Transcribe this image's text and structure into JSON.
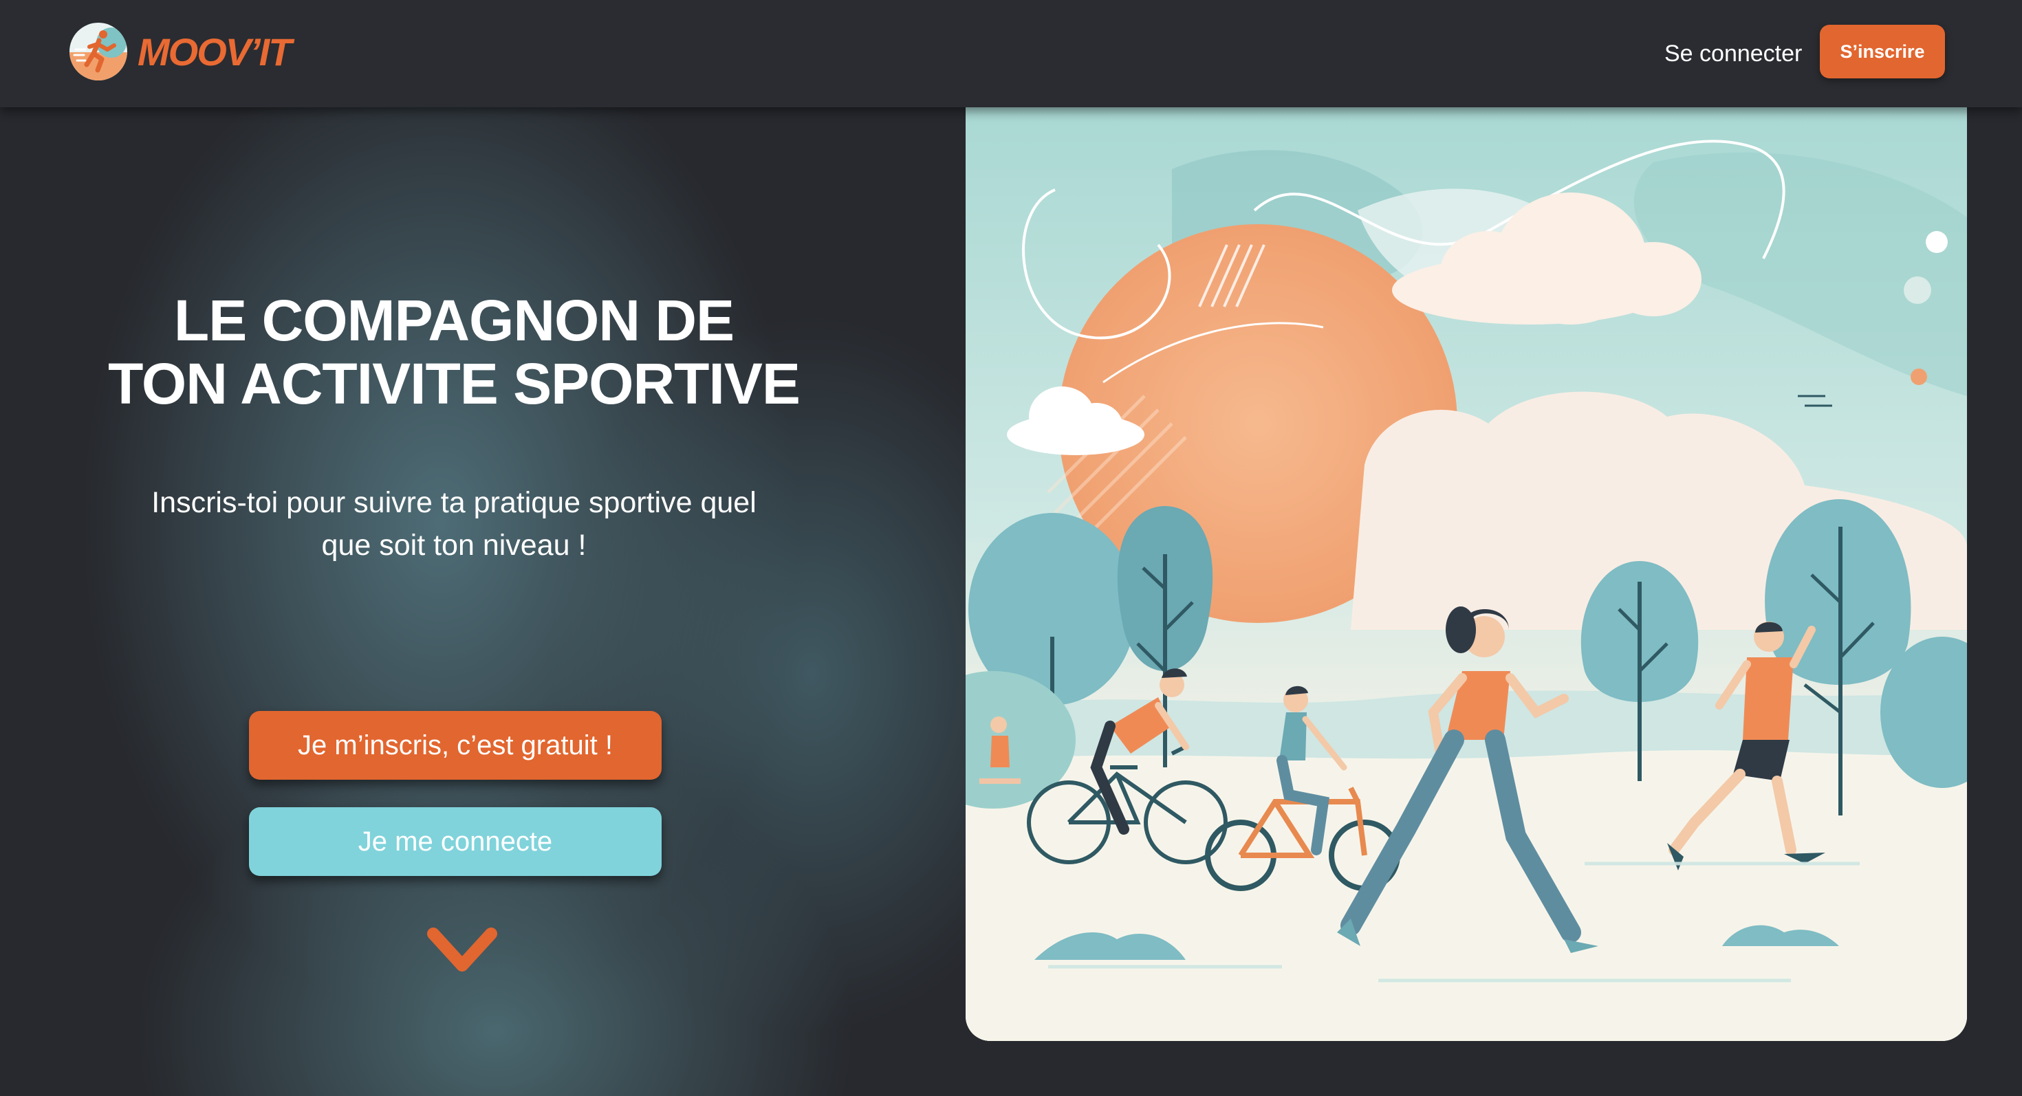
{
  "navbar": {
    "logo_text": "MOOV’IT",
    "login_label": "Se connecter",
    "signup_label": "S’inscrire"
  },
  "hero": {
    "title_line1": "LE COMPAGNON DE",
    "title_line2": "TON ACTIVITE SPORTIVE",
    "subtitle_line1": "Inscris-toi pour suivre ta pratique sportive quel",
    "subtitle_line2": "que soit ton niveau !",
    "primary_cta": "Je m’inscris, c’est gratuit !",
    "secondary_cta": "Je me connecte"
  },
  "icons": {
    "logo": "runner-logo-icon",
    "scroll": "chevron-down-icon"
  },
  "colors": {
    "background": "#27292e",
    "navbar": "#2a2c31",
    "accent_orange": "#e2662f",
    "accent_teal": "#80d3db",
    "text": "#ffffff"
  }
}
